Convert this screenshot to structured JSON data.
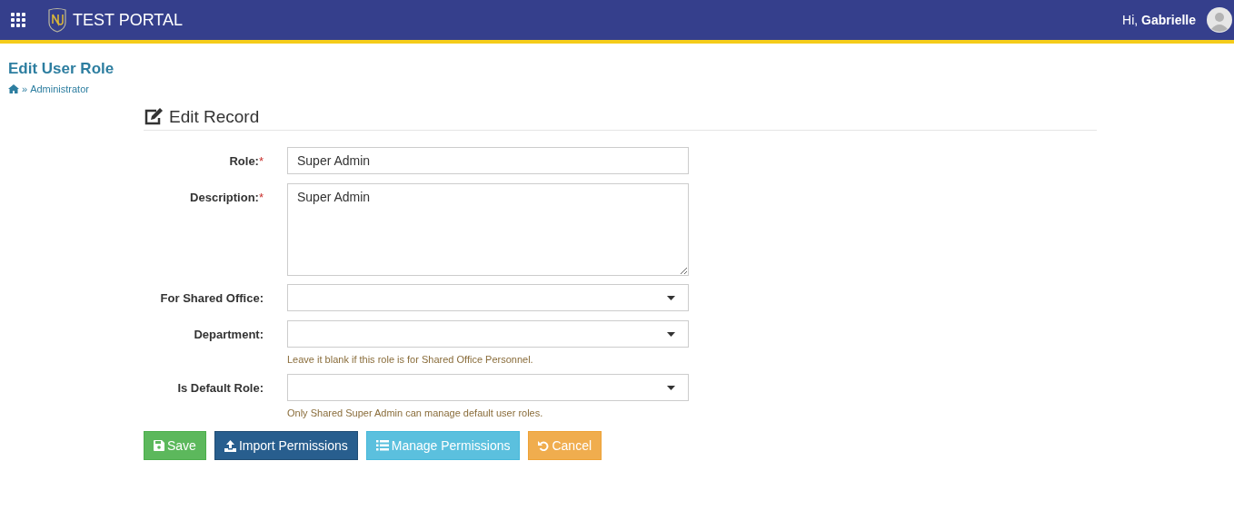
{
  "header": {
    "title": "TEST PORTAL",
    "greeting": "Hi,",
    "user": "Gabrielle"
  },
  "page": {
    "title": "Edit User Role",
    "breadcrumb": [
      "»",
      "Administrator"
    ]
  },
  "form": {
    "title": "Edit Record",
    "fields": [
      {
        "kind": "text",
        "label": "Role:",
        "required_mark": "*",
        "value": "Super Admin"
      },
      {
        "kind": "textarea",
        "label": "Description:",
        "required_mark": "*",
        "value": "Super Admin"
      },
      {
        "kind": "select",
        "label": "For Shared Office:"
      },
      {
        "kind": "select",
        "label": "Department:",
        "help": "Leave it blank if this role is for Shared Office Personnel."
      },
      {
        "kind": "select",
        "label": "Is Default Role:",
        "help": "Only Shared Super Admin can manage default user roles."
      }
    ],
    "buttons": [
      {
        "kind": "save",
        "label": "Save"
      },
      {
        "kind": "import",
        "label": "Import Permissions"
      },
      {
        "kind": "manage",
        "label": "Manage Permissions"
      },
      {
        "kind": "cancel",
        "label": "Cancel"
      }
    ]
  }
}
